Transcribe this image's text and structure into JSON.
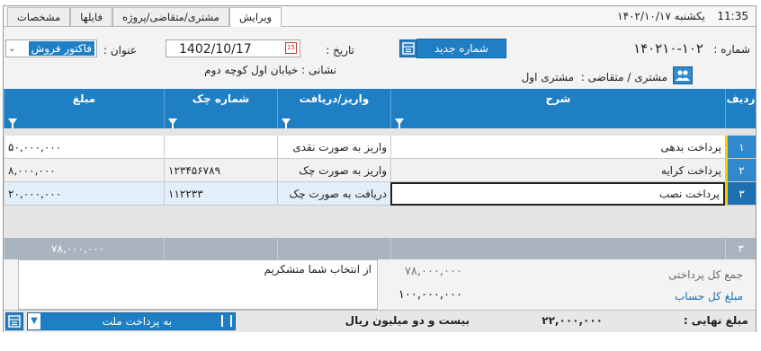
{
  "topbar": {
    "time": "11:35",
    "day": "یکشنبه",
    "date": "۱۴۰۲/۱۰/۱۷",
    "tabs": [
      "ویرایش",
      "مشتری/متقاضی/پروژه",
      "فایلها",
      "مشخصات"
    ],
    "active_tab": "ویرایش"
  },
  "header": {
    "number_label": "شماره :",
    "number_value": "۱۴۰۲۱۰-۱۰۲",
    "new_number_button": "شماره جدید",
    "date_label": "تاریخ :",
    "date_value": "1402/10/17",
    "title_label": "عنوان :",
    "title_value": "فاکتور فروش",
    "customer_label": "مشتری / متقاضی :",
    "customer_value": "مشتری اول",
    "address_text": "نشانی : خیابان اول کوچه دوم"
  },
  "table": {
    "columns": [
      "ردیف",
      "شرح",
      "واریز/دریافت",
      "شماره چک",
      "مبلغ"
    ],
    "rows": [
      {
        "row": "۱",
        "desc": "پرداخت بدهی",
        "type": "واریز به صورت نقدی",
        "check": "",
        "amount": "۵۰,۰۰۰,۰۰۰"
      },
      {
        "row": "۲",
        "desc": "پرداخت کرایه",
        "type": "واریز به صورت چک",
        "check": "۱۲۳۴۵۶۷۸۹",
        "amount": "۸,۰۰۰,۰۰۰"
      },
      {
        "row": "۳",
        "desc": "پرداخت نصب",
        "type": "دریافت به صورت چک",
        "check": "۱۱۲۲۳۳",
        "amount": "۲۰,۰۰۰,۰۰۰"
      }
    ],
    "total_count": "۳",
    "total_amount": "۷۸,۰۰۰,۰۰۰"
  },
  "summary": {
    "total_payment_label": "جمع کل پرداختی",
    "total_payment_value": "۷۸,۰۰۰,۰۰۰",
    "account_total_label": "مبلغ کل حساب",
    "account_total_value": "۱۰۰,۰۰۰,۰۰۰",
    "note": "از انتخاب شما متشکریم",
    "final_label": "مبلغ نهایی :",
    "final_value": "۲۲,۰۰۰,۰۰۰",
    "final_words": "بیست و دو میلیون  ریال",
    "payment_select": "به پرداخت ملت"
  },
  "colors": {
    "accent": "#1f7fc4",
    "row_marker": "#f0d000",
    "total_bg": "#a9b4bf"
  }
}
